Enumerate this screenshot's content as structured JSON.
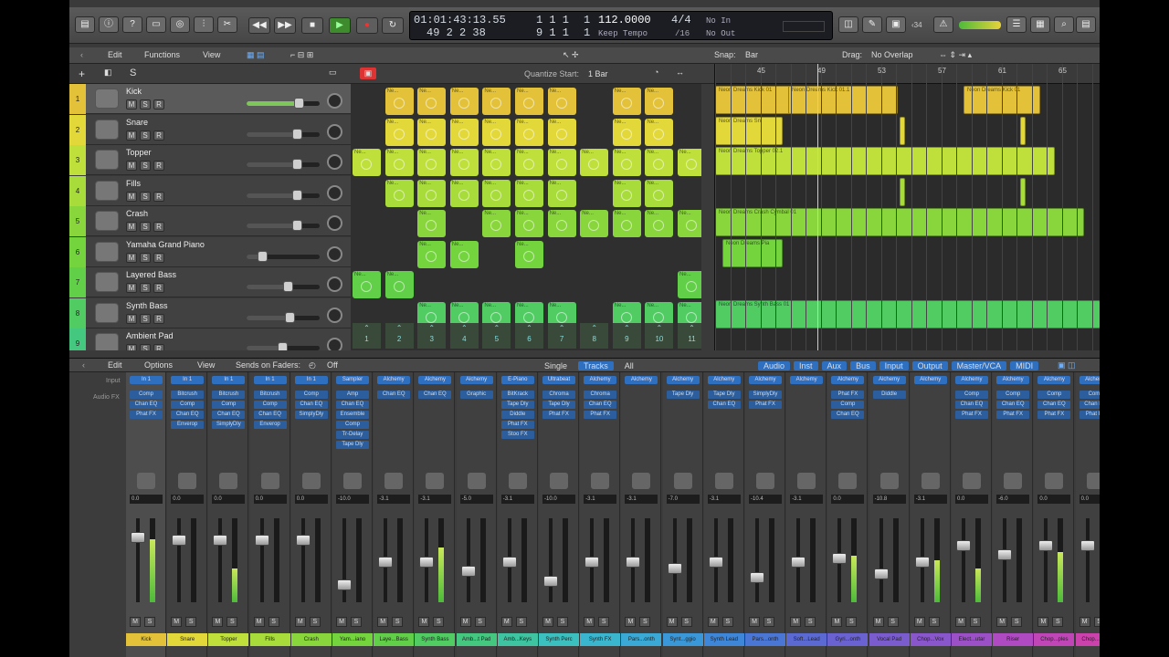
{
  "control_bar": {
    "lcd": {
      "position_time": "01:01:43:13.55",
      "position_bars": "49  2  2    38",
      "field_a_top": "1   1   1",
      "field_a_bottom": "9   1   1",
      "field_b_top": "1",
      "field_b_bottom": "1",
      "tempo": "112.0000",
      "tempo_mode": "Keep Tempo",
      "sig_top": "4/4",
      "sig_bottom": "/16",
      "midi_in": "No In",
      "midi_out": "No Out"
    },
    "cpu_value": "‹34"
  },
  "tracks_header": {
    "edit": "Edit",
    "functions": "Functions",
    "view": "View",
    "snap_label": "Snap:",
    "snap_value": "Bar",
    "drag_label": "Drag:",
    "drag_value": "No Overlap"
  },
  "tracks_sub": {
    "quantize_label": "Quantize Start:",
    "quantize_value": "1 Bar",
    "ruler": [
      "45",
      "49",
      "53",
      "57",
      "61",
      "65"
    ]
  },
  "tracks": [
    {
      "num": "1",
      "name": "Kick",
      "color": "#e3c23a",
      "vol": 0.72,
      "sel": true
    },
    {
      "num": "2",
      "name": "Snare",
      "color": "#e3d83a",
      "vol": 0.7
    },
    {
      "num": "3",
      "name": "Topper",
      "color": "#bfe03a",
      "vol": 0.7
    },
    {
      "num": "4",
      "name": "Fills",
      "color": "#a8dc3a",
      "vol": 0.7
    },
    {
      "num": "5",
      "name": "Crash",
      "color": "#89d63c",
      "vol": 0.7
    },
    {
      "num": "6",
      "name": "Yamaha Grand Piano",
      "color": "#74d43e",
      "vol": 0.22
    },
    {
      "num": "7",
      "name": "Layered Bass",
      "color": "#62cf48",
      "vol": 0.58
    },
    {
      "num": "8",
      "name": "Synth Bass",
      "color": "#50cc62",
      "vol": 0.6
    },
    {
      "num": "9",
      "name": "Ambient Pad",
      "color": "#44c880",
      "vol": 0.5
    }
  ],
  "loop_label": "Ne...",
  "loop_triggers": [
    "1",
    "2",
    "3",
    "4",
    "5",
    "6",
    "7",
    "8",
    "9",
    "10",
    "11"
  ],
  "regions": {
    "kick": "Neon Dreams Kick 01.1",
    "kick2": "Neon Dreams Kick 01",
    "snare": "Neon Dreams Sn",
    "topper": "Neon Dreams Topper 02.1",
    "crash": "Neon Dreams Crash Cymbal 01",
    "piano": "Neon Dreams Pia",
    "bass": "Neon Dreams Synth Bass 01"
  },
  "mixer_header": {
    "edit": "Edit",
    "options": "Options",
    "view": "View",
    "sends": "Sends on Faders:",
    "sends_value": "Off",
    "modes": [
      "Single",
      "Tracks",
      "All"
    ],
    "filters": [
      "Audio",
      "Inst",
      "Aux",
      "Bus",
      "Input",
      "Output",
      "Master/VCA",
      "MIDI"
    ]
  },
  "mixer_labels": {
    "input": "Input",
    "audio_fx": "Audio FX"
  },
  "strips": [
    {
      "name": "Kick",
      "input": "In 1",
      "plugins": [
        "Comp",
        "Chan EQ",
        "Phat FX"
      ],
      "value": "0.0",
      "color": "#e3c23a",
      "fader": 0.82,
      "level": 0.75,
      "sel": true
    },
    {
      "name": "Snare",
      "input": "In 1",
      "plugins": [
        "Bitcrush",
        "Comp",
        "Chan EQ",
        "Enverop"
      ],
      "value": "0.0",
      "color": "#e3d83a",
      "fader": 0.78,
      "level": 0.0
    },
    {
      "name": "Topper",
      "input": "In 1",
      "plugins": [
        "Bitcrush",
        "Comp",
        "Chan EQ",
        "SimplyDly"
      ],
      "value": "0.0",
      "color": "#bfe03a",
      "fader": 0.78,
      "level": 0.4
    },
    {
      "name": "Fills",
      "input": "In 1",
      "plugins": [
        "Bitcrush",
        "Comp",
        "Chan EQ",
        "Enverop"
      ],
      "value": "0.0",
      "color": "#a8dc3a",
      "fader": 0.78,
      "level": 0.0
    },
    {
      "name": "Crash",
      "input": "In 1",
      "plugins": [
        "Comp",
        "Chan EQ",
        "SimplyDly"
      ],
      "value": "0.0",
      "color": "#89d63c",
      "fader": 0.78,
      "level": 0.0
    },
    {
      "name": "Yam...iano",
      "input": "Sampler",
      "plugins": [
        "Amp",
        "Chan EQ",
        "Ensemble",
        "Comp",
        "Tr-Delay",
        "Tape Dly"
      ],
      "value": "-10.0",
      "color": "#74d43e",
      "fader": 0.2,
      "level": 0.0
    },
    {
      "name": "Laye...Bass",
      "input": "Alchemy",
      "plugins": [
        "Chan EQ"
      ],
      "value": "-3.1",
      "color": "#62cf48",
      "fader": 0.5,
      "level": 0.0
    },
    {
      "name": "Synth Bass",
      "input": "Alchemy",
      "plugins": [
        "Chan EQ"
      ],
      "value": "-3.1",
      "color": "#50cc62",
      "fader": 0.5,
      "level": 0.65
    },
    {
      "name": "Amb...t Pad",
      "input": "Alchemy",
      "plugins": [
        "Graphic"
      ],
      "value": "-5.0",
      "color": "#44c880",
      "fader": 0.38,
      "level": 0.0
    },
    {
      "name": "Amb...Keys",
      "input": "E-Piano",
      "plugins": [
        "BitKrack",
        "Tape Dly",
        "Diddle",
        "Phat FX",
        "Stoo FX"
      ],
      "value": "-3.1",
      "color": "#3ec4a0",
      "fader": 0.5,
      "level": 0.0
    },
    {
      "name": "Synth Perc",
      "input": "Ultrabeat",
      "plugins": [
        "Chroma",
        "Tape Dly",
        "Phat FX"
      ],
      "value": "-10.0",
      "color": "#3cbfbf",
      "fader": 0.25,
      "level": 0.0
    },
    {
      "name": "Synth FX",
      "input": "Alchemy",
      "plugins": [
        "Chroma",
        "Chan EQ",
        "Phat FX"
      ],
      "value": "-3.1",
      "color": "#3ab7cf",
      "fader": 0.5,
      "level": 0.0
    },
    {
      "name": "Pars...onth",
      "input": "Alchemy",
      "plugins": [],
      "value": "-3.1",
      "color": "#3aa9d6",
      "fader": 0.5,
      "level": 0.0
    },
    {
      "name": "Synt...ggio",
      "input": "Alchemy",
      "plugins": [
        "Tape Dly"
      ],
      "value": "-7.0",
      "color": "#3a98d9",
      "fader": 0.42,
      "level": 0.0
    },
    {
      "name": "Synth Lead",
      "input": "Alchemy",
      "plugins": [
        "Tape Dly",
        "Chan EQ"
      ],
      "value": "-3.1",
      "color": "#3e86d8",
      "fader": 0.5,
      "level": 0.0
    },
    {
      "name": "Pars...onth",
      "input": "Alchemy",
      "plugins": [
        "SimplyDly",
        "Phat FX"
      ],
      "value": "-10.4",
      "color": "#4a77d6",
      "fader": 0.3,
      "level": 0.0
    },
    {
      "name": "Soft...Lead",
      "input": "Alchemy",
      "plugins": [],
      "value": "-3.1",
      "color": "#5a6ad2",
      "fader": 0.5,
      "level": 0.0
    },
    {
      "name": "Gyri...onth",
      "input": "Alchemy",
      "plugins": [
        "Phat FX",
        "Comp",
        "Chan EQ"
      ],
      "value": "0.0",
      "color": "#6a62d0",
      "fader": 0.55,
      "level": 0.55
    },
    {
      "name": "Vocal Pad",
      "input": "Alchemy",
      "plugins": [
        "Diddle"
      ],
      "value": "-10.8",
      "color": "#7a5ccf",
      "fader": 0.35,
      "level": 0.0
    },
    {
      "name": "Chop...Vox",
      "input": "Alchemy",
      "plugins": [],
      "value": "-3.1",
      "color": "#8a56cc",
      "fader": 0.5,
      "level": 0.5
    },
    {
      "name": "Elect...utar",
      "input": "Alchemy",
      "plugins": [
        "Comp",
        "Chan EQ",
        "Phat FX"
      ],
      "value": "0.0",
      "color": "#9c50c8",
      "fader": 0.72,
      "level": 0.4
    },
    {
      "name": "Riser",
      "input": "Alchemy",
      "plugins": [
        "Comp",
        "Chan EQ",
        "Phat FX"
      ],
      "value": "-6.0",
      "color": "#b04ac2",
      "fader": 0.6,
      "level": 0.0
    },
    {
      "name": "Chop...ples",
      "input": "Alchemy",
      "plugins": [
        "Comp",
        "Chan EQ",
        "Phat FX"
      ],
      "value": "0.0",
      "color": "#c046b8",
      "fader": 0.72,
      "level": 0.6
    },
    {
      "name": "Chop...ples",
      "input": "Alchemy",
      "plugins": [
        "Comp",
        "Chan EQ",
        "Phat FX"
      ],
      "value": "0.0",
      "color": "#cc42ad",
      "fader": 0.72,
      "level": 0.0
    }
  ]
}
